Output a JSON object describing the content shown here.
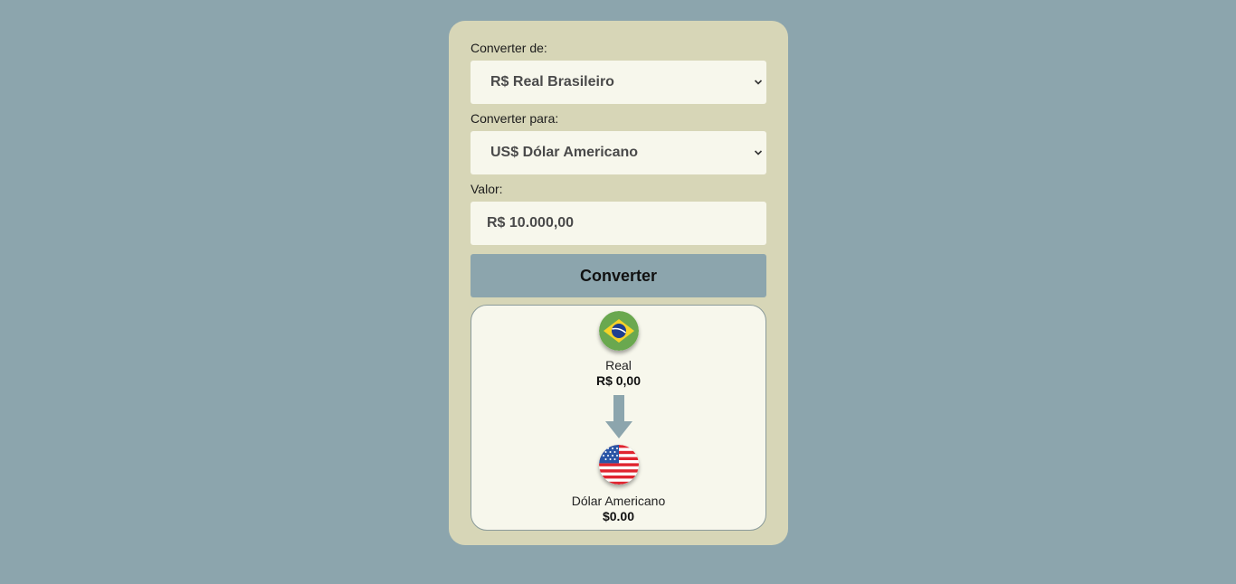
{
  "form": {
    "from_label": "Converter de:",
    "from_selected": "R$ Real Brasileiro",
    "to_label": "Converter para:",
    "to_selected": "US$ Dólar Americano",
    "value_label": "Valor:",
    "value_input": "R$ 10.000,00",
    "convert_button": "Converter"
  },
  "result": {
    "from": {
      "name": "Real",
      "value": "R$ 0,00",
      "icon": "brazil-flag-icon"
    },
    "to": {
      "name": "Dólar Americano",
      "value": "$0.00",
      "icon": "usa-flag-icon"
    },
    "arrow_icon": "arrow-down-icon"
  },
  "colors": {
    "background": "#8ca5ad",
    "card": "#d7d6b7",
    "field": "#f7f7ec",
    "button": "#8ca5ad"
  }
}
